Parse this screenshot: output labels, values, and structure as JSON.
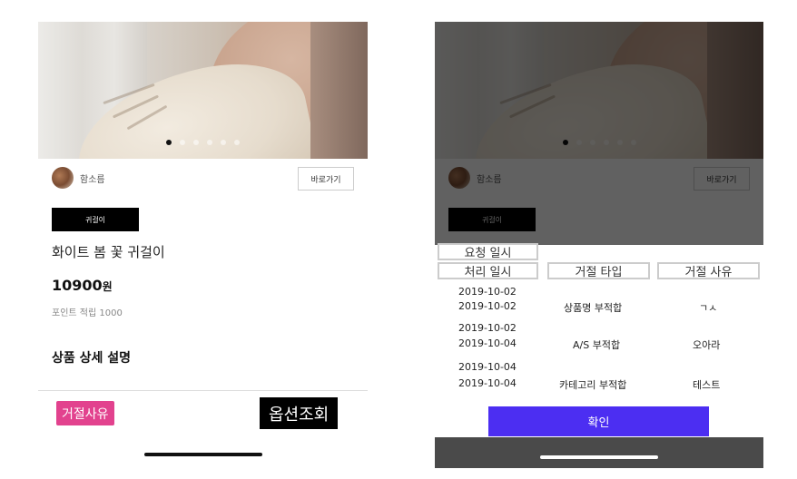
{
  "product": {
    "seller_name": "함소름",
    "shortcut_label": "바로가기",
    "tag_label": "귀걸이",
    "title": "화이트 봄 꽃 귀걸이",
    "price_value": "10900",
    "price_unit": "원",
    "point_text": "포인트 적립 1000",
    "detail_heading": "상품 상세 설명",
    "reject_reason_label": "거절사유",
    "option_lookup_label": "옵션조회"
  },
  "modal": {
    "headers": {
      "requested_at": "요청 일시",
      "processed_at": "처리 일시",
      "reject_type": "거절 타입",
      "reject_reason": "거절 사유"
    },
    "rows": [
      {
        "requested_at": "2019-10-02",
        "processed_at": "2019-10-02",
        "reject_type": "상품명 부적합",
        "reject_reason": "ㄱㅅ"
      },
      {
        "requested_at": "2019-10-02",
        "processed_at": "2019-10-04",
        "reject_type": "A/S 부적합",
        "reject_reason": "오아라"
      },
      {
        "requested_at": "2019-10-04",
        "processed_at": "2019-10-04",
        "reject_type": "카테고리 부적합",
        "reject_reason": "테스트"
      }
    ],
    "confirm_label": "확인"
  },
  "carousel": {
    "dot_count": 6,
    "active_index": 0
  },
  "colors": {
    "reject_button": "#e2428e",
    "option_button": "#000000",
    "confirm_button": "#4c2ef2",
    "overlay": "#000000",
    "bottom_bar": "#4a4a4a"
  }
}
